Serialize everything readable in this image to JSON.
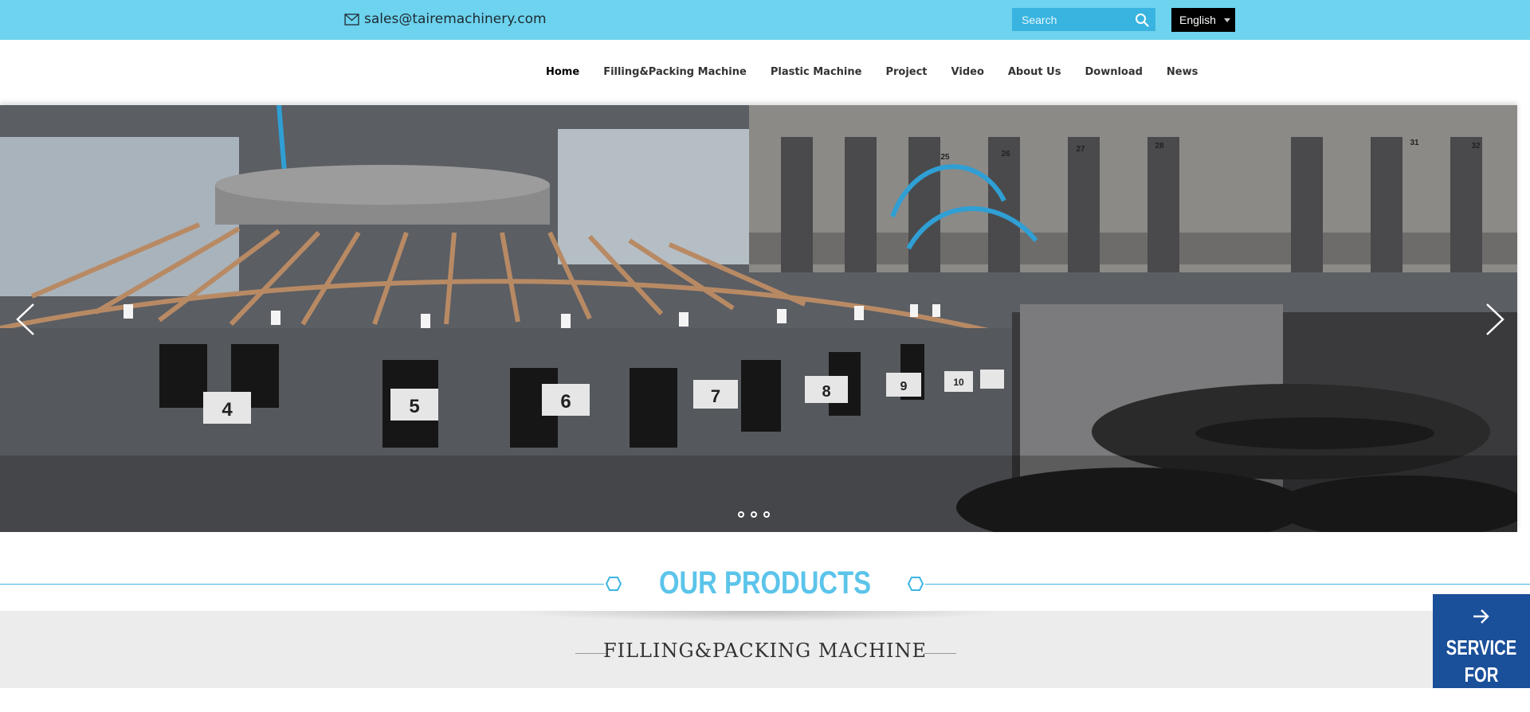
{
  "topbar": {
    "email": "sales@tairemachinery.com",
    "search_placeholder": "Search",
    "language": "English",
    "colors": {
      "bar": "#6dd3ee",
      "search": "#39b4e0"
    }
  },
  "nav": {
    "items": [
      {
        "label": "Home",
        "active": true
      },
      {
        "label": "Filling&Packing Machine"
      },
      {
        "label": "Plastic Machine"
      },
      {
        "label": "Project"
      },
      {
        "label": "Video"
      },
      {
        "label": "About Us"
      },
      {
        "label": "Download"
      },
      {
        "label": "News"
      }
    ]
  },
  "carousel": {
    "slide_labels": [
      "4",
      "5",
      "6",
      "7",
      "8",
      "9",
      "10",
      "25",
      "26",
      "27",
      "28",
      "31",
      "32"
    ],
    "slides_count": 3
  },
  "products": {
    "title": "OUR PRODUCTS",
    "category": "FILLING&PACKING MACHINE",
    "accent": "#5bc4ea"
  },
  "service": {
    "line1": "SERVICE",
    "line2": "FOR YOU!",
    "color": "#1a4f99"
  }
}
